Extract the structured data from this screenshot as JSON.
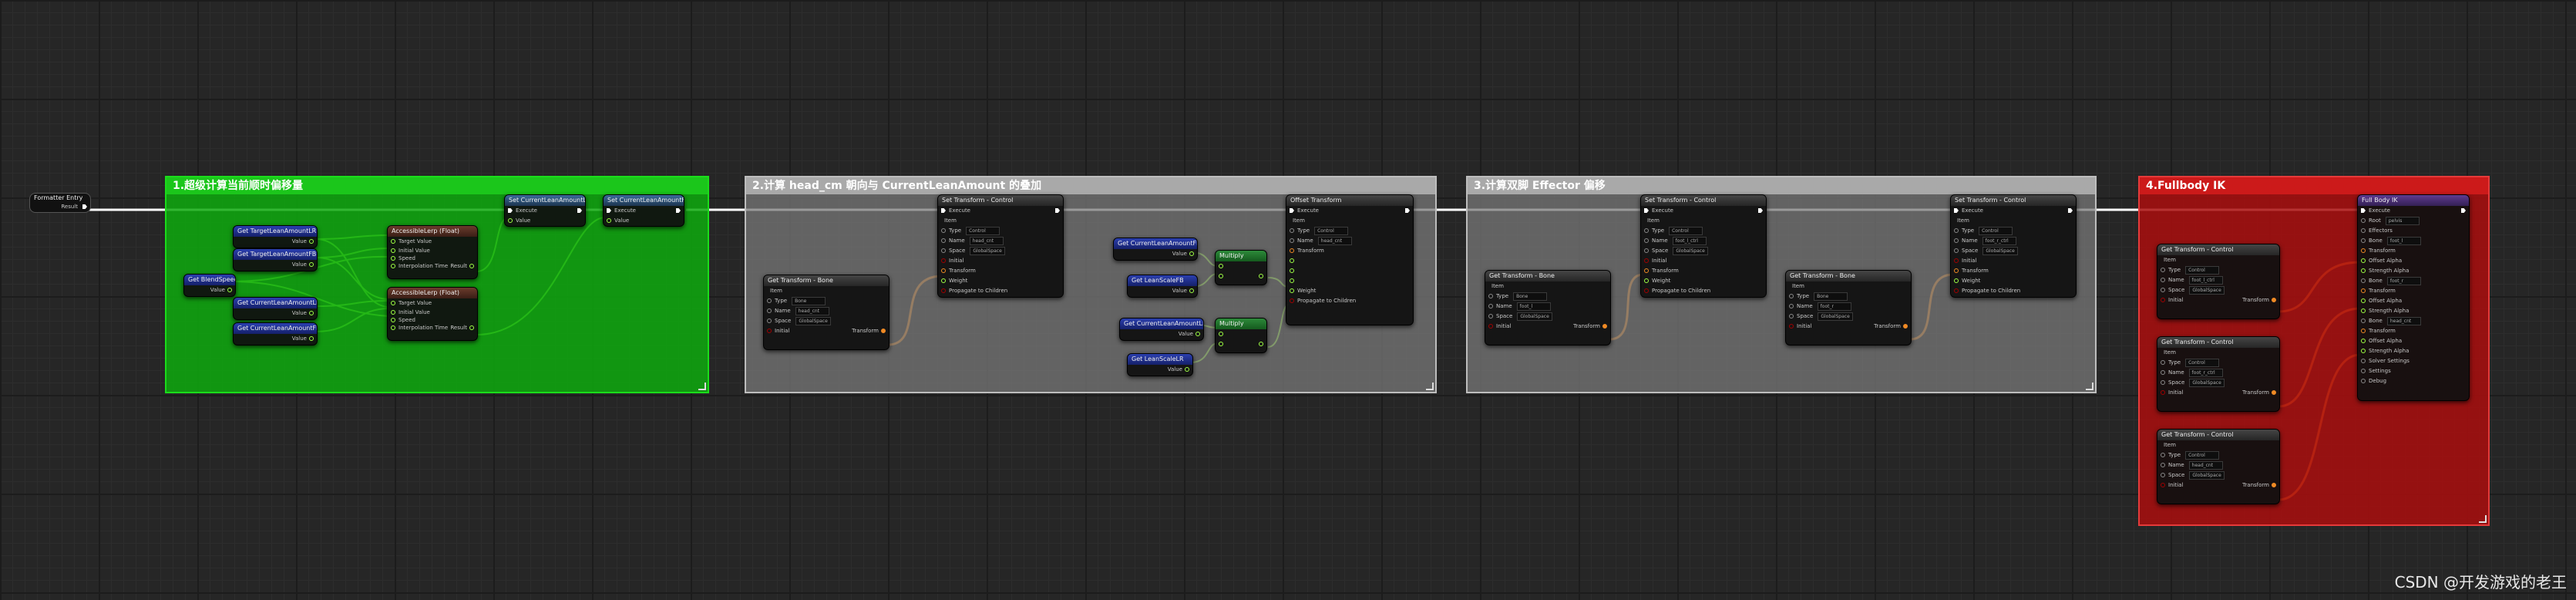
{
  "comments": {
    "group1": "1.超级计算当前顺时偏移量",
    "group2": "2.计算 head_cm 朝向与 CurrentLeanAmount 的叠加",
    "group3": "3.计算双脚 Effector 偏移",
    "group4": "4.Fullbody IK"
  },
  "entry": {
    "title": "Formatter Entry",
    "pin": "Result"
  },
  "g1": {
    "get_target_lr": "Get TargetLeanAmountLR",
    "get_target_fb": "Get TargetLeanAmountFB",
    "get_blend": "Get BlendSpeed",
    "get_current_lr": "Get CurrentLeanAmountLR",
    "get_current_fb": "Get CurrentLeanAmountFB",
    "value": "Value",
    "interp1": "AccessibleLerp (Float)",
    "interp2": "AccessibleLerp (Float)",
    "interp_pins": [
      "Target Value",
      "Initial Value",
      "Speed",
      "Interpolation Time"
    ],
    "result": "Result",
    "set_lr": "Set CurrentLeanAmountLR",
    "set_fb": "Set CurrentLeanAmountFB",
    "execute": "Execute",
    "value_pin": "Value"
  },
  "g2": {
    "get_transform": "Get Transform - Bone",
    "set_transform": "Set Transform - Control",
    "get_cur_fb": "Get CurrentLeanAmountFB",
    "get_lean_fb": "Get LeanScaleFB",
    "get_cur_lr": "Get CurrentLeanAmountLR",
    "get_lean_lr": "Get LeanScaleLR",
    "multiply": "Multiply",
    "offset": "Offset Transform",
    "item": "Item",
    "type": "Type",
    "name": "Name",
    "space": "Space",
    "initial": "Initial",
    "transform": "Transform",
    "weight": "Weight",
    "propagate": "Propagate to Children",
    "bone_val": "Bone",
    "head_val": "head_cnt",
    "space_val": "GlobalSpace",
    "control_val": "Control"
  },
  "g3": {
    "get_transform": "Get Transform - Bone",
    "set_transform": "Set Transform - Control",
    "foot_l": "foot_l_ctrl",
    "foot_r": "foot_r_ctrl",
    "foot_l_bone": "foot_l",
    "foot_r_bone": "foot_r"
  },
  "g4": {
    "get_transform": "Get Transform - Control",
    "fbik": "Full Body IK",
    "root": "Root",
    "pelvis": "pelvis",
    "effectors": "Effectors",
    "bone": "Bone",
    "offset_alpha": "Offset Alpha",
    "strength_alpha": "Strength Alpha",
    "pull_chain_alpha": "Pull Chain Alpha",
    "solver_settings": "Solver Settings",
    "settings": "Settings",
    "debug": "Debug"
  },
  "watermark": "CSDN @开发游戏的老王",
  "colors": {
    "exec": "#ffffff",
    "float": "#9fff44",
    "transform": "#f08a24"
  }
}
